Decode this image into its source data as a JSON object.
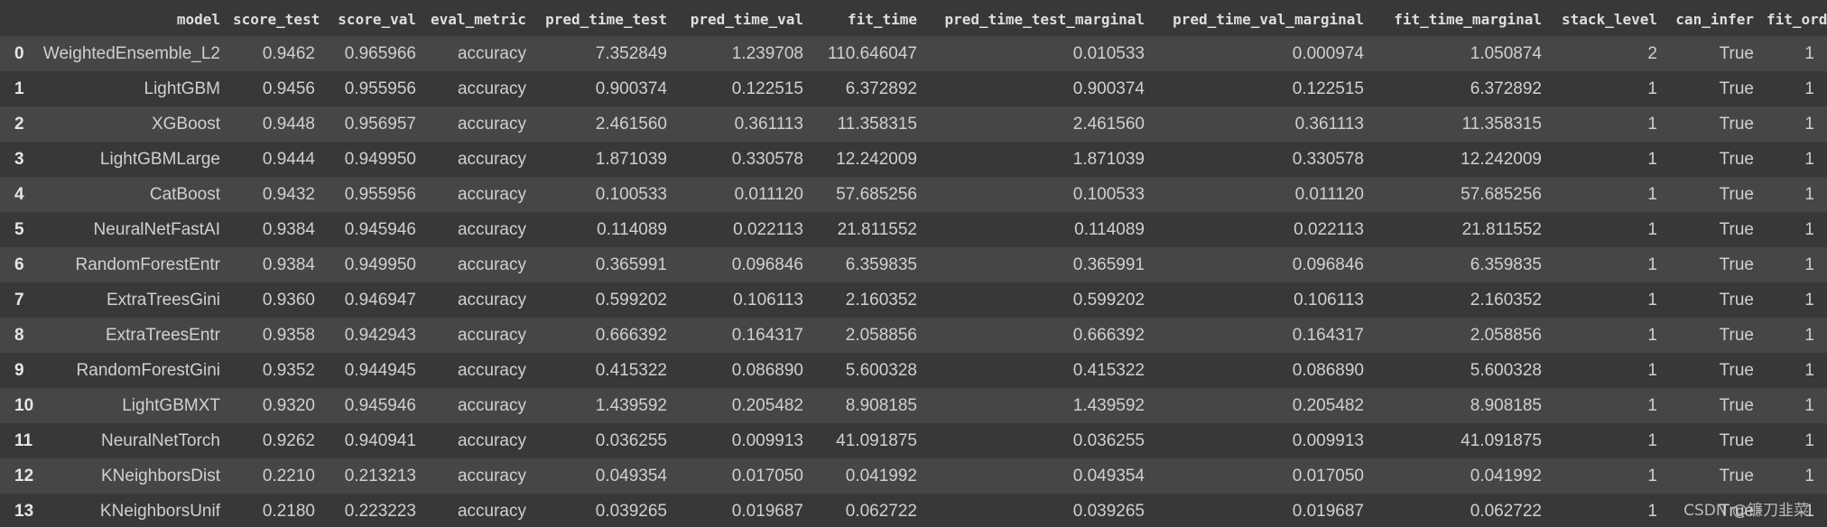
{
  "columns": [
    "",
    "model",
    "score_test",
    "score_val",
    "eval_metric",
    "pred_time_test",
    "pred_time_val",
    "fit_time",
    "pred_time_test_marginal",
    "pred_time_val_marginal",
    "fit_time_marginal",
    "stack_level",
    "can_infer",
    "fit_orde"
  ],
  "rows": [
    [
      "0",
      "WeightedEnsemble_L2",
      "0.9462",
      "0.965966",
      "accuracy",
      "7.352849",
      "1.239708",
      "110.646047",
      "0.010533",
      "0.000974",
      "1.050874",
      "2",
      "True",
      "1"
    ],
    [
      "1",
      "LightGBM",
      "0.9456",
      "0.955956",
      "accuracy",
      "0.900374",
      "0.122515",
      "6.372892",
      "0.900374",
      "0.122515",
      "6.372892",
      "1",
      "True",
      "1"
    ],
    [
      "2",
      "XGBoost",
      "0.9448",
      "0.956957",
      "accuracy",
      "2.461560",
      "0.361113",
      "11.358315",
      "2.461560",
      "0.361113",
      "11.358315",
      "1",
      "True",
      "1"
    ],
    [
      "3",
      "LightGBMLarge",
      "0.9444",
      "0.949950",
      "accuracy",
      "1.871039",
      "0.330578",
      "12.242009",
      "1.871039",
      "0.330578",
      "12.242009",
      "1",
      "True",
      "1"
    ],
    [
      "4",
      "CatBoost",
      "0.9432",
      "0.955956",
      "accuracy",
      "0.100533",
      "0.011120",
      "57.685256",
      "0.100533",
      "0.011120",
      "57.685256",
      "1",
      "True",
      "1"
    ],
    [
      "5",
      "NeuralNetFastAI",
      "0.9384",
      "0.945946",
      "accuracy",
      "0.114089",
      "0.022113",
      "21.811552",
      "0.114089",
      "0.022113",
      "21.811552",
      "1",
      "True",
      "1"
    ],
    [
      "6",
      "RandomForestEntr",
      "0.9384",
      "0.949950",
      "accuracy",
      "0.365991",
      "0.096846",
      "6.359835",
      "0.365991",
      "0.096846",
      "6.359835",
      "1",
      "True",
      "1"
    ],
    [
      "7",
      "ExtraTreesGini",
      "0.9360",
      "0.946947",
      "accuracy",
      "0.599202",
      "0.106113",
      "2.160352",
      "0.599202",
      "0.106113",
      "2.160352",
      "1",
      "True",
      "1"
    ],
    [
      "8",
      "ExtraTreesEntr",
      "0.9358",
      "0.942943",
      "accuracy",
      "0.666392",
      "0.164317",
      "2.058856",
      "0.666392",
      "0.164317",
      "2.058856",
      "1",
      "True",
      "1"
    ],
    [
      "9",
      "RandomForestGini",
      "0.9352",
      "0.944945",
      "accuracy",
      "0.415322",
      "0.086890",
      "5.600328",
      "0.415322",
      "0.086890",
      "5.600328",
      "1",
      "True",
      "1"
    ],
    [
      "10",
      "LightGBMXT",
      "0.9320",
      "0.945946",
      "accuracy",
      "1.439592",
      "0.205482",
      "8.908185",
      "1.439592",
      "0.205482",
      "8.908185",
      "1",
      "True",
      "1"
    ],
    [
      "11",
      "NeuralNetTorch",
      "0.9262",
      "0.940941",
      "accuracy",
      "0.036255",
      "0.009913",
      "41.091875",
      "0.036255",
      "0.009913",
      "41.091875",
      "1",
      "True",
      "1"
    ],
    [
      "12",
      "KNeighborsDist",
      "0.2210",
      "0.213213",
      "accuracy",
      "0.049354",
      "0.017050",
      "0.041992",
      "0.049354",
      "0.017050",
      "0.041992",
      "1",
      "True",
      "1"
    ],
    [
      "13",
      "KNeighborsUnif",
      "0.2180",
      "0.223223",
      "accuracy",
      "0.039265",
      "0.019687",
      "0.062722",
      "0.039265",
      "0.019687",
      "0.062722",
      "1",
      "True",
      "1"
    ]
  ],
  "watermark": "CSDN @镰刀韭菜"
}
